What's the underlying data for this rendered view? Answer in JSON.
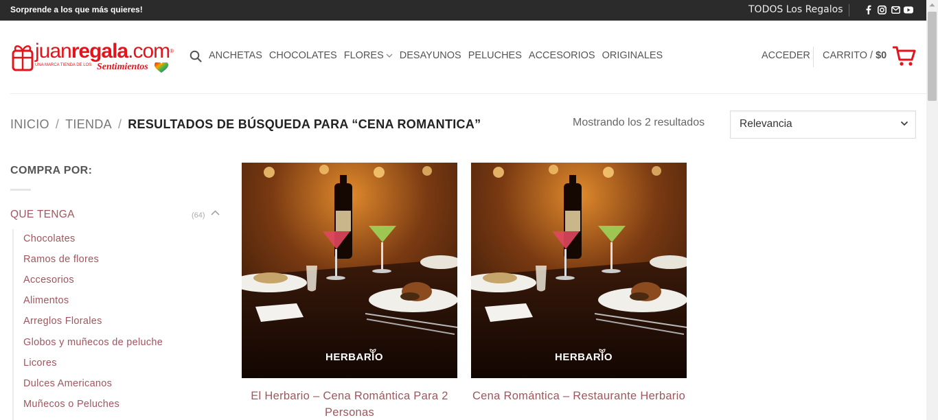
{
  "topbar": {
    "promo": "Sorprende a los que más quieres!",
    "all_gifts": "TODOS Los Regalos",
    "social": [
      "facebook-icon",
      "instagram-icon",
      "mail-icon",
      "youtube-icon"
    ]
  },
  "logo": {
    "word_light": "juan",
    "word_bold": "regala",
    "word_tail": ".com",
    "reg": "®",
    "tagline": "UNA MARCA TIENDA DE LOS",
    "script": "Sentimientos"
  },
  "nav": {
    "items": [
      "ANCHETAS",
      "CHOCOLATES",
      "FLORES",
      "DESAYUNOS",
      "PELUCHES",
      "ACCESORIOS",
      "ORIGINALES"
    ],
    "login": "ACCEDER",
    "cart_label": "CARRITO",
    "cart_sep": "/",
    "cart_amount": "$0"
  },
  "breadcrumb": {
    "home": "INICIO",
    "shop": "TIENDA",
    "sep": "/",
    "current": "RESULTADOS DE BÚSQUEDA PARA “CENA ROMANTICA”"
  },
  "results_text": "Mostrando los 2 resultados",
  "sort": {
    "selected": "Relevancia"
  },
  "sidebar": {
    "title": "COMPRA POR:",
    "category": "QUE TENGA",
    "count": "(64)",
    "items": [
      "Chocolates",
      "Ramos de flores",
      "Accesorios",
      "Alimentos",
      "Arreglos Florales",
      "Globos y muñecos de peluche",
      "Licores",
      "Dulces Americanos",
      "Muñecos o Peluches"
    ]
  },
  "products": [
    {
      "title": "El Herbario – Cena Romántica Para 2 Personas",
      "brand": "HERBARIO"
    },
    {
      "title": "Cena Romántica – Restaurante Herbario",
      "brand": "HERBARIO"
    }
  ],
  "colors": {
    "brand": "#e2151c",
    "link": "#a0555c",
    "topbar": "#2b2b2b"
  }
}
